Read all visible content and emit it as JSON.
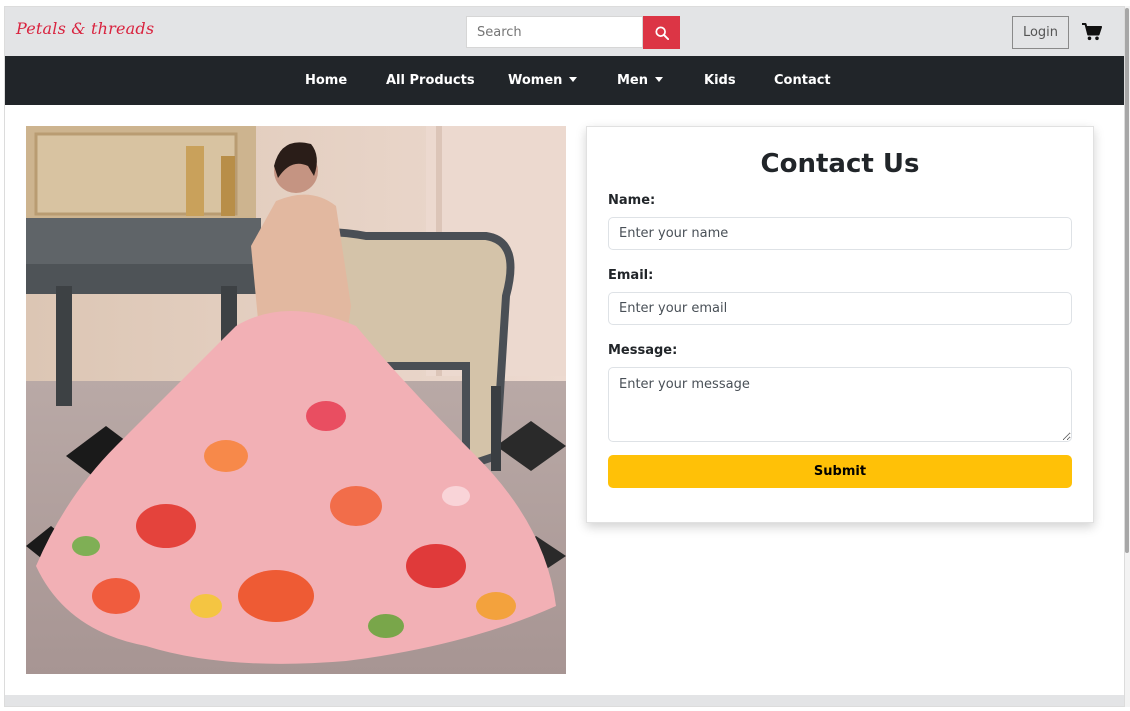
{
  "brand": {
    "name": "Petals & threads",
    "color": "#d9233f"
  },
  "search": {
    "placeholder": "Search",
    "button_icon": "search-icon",
    "button_color": "#dc3545"
  },
  "header": {
    "login_label": "Login",
    "cart_icon": "cart-icon"
  },
  "nav": {
    "items": [
      {
        "label": "Home",
        "dropdown": false
      },
      {
        "label": "All Products",
        "dropdown": false
      },
      {
        "label": "Women",
        "dropdown": true
      },
      {
        "label": "Men",
        "dropdown": true
      },
      {
        "label": "Kids",
        "dropdown": false
      },
      {
        "label": "Contact",
        "dropdown": false
      }
    ],
    "background": "#212529"
  },
  "hero_image": {
    "subject": "woman in floral lehenga seated on armchair"
  },
  "contact_form": {
    "title": "Contact Us",
    "name_label": "Name:",
    "name_placeholder": "Enter your name",
    "email_label": "Email:",
    "email_placeholder": "Enter your email",
    "message_label": "Message:",
    "message_placeholder": "Enter your message",
    "submit_label": "Submit",
    "submit_color": "#ffc107"
  }
}
